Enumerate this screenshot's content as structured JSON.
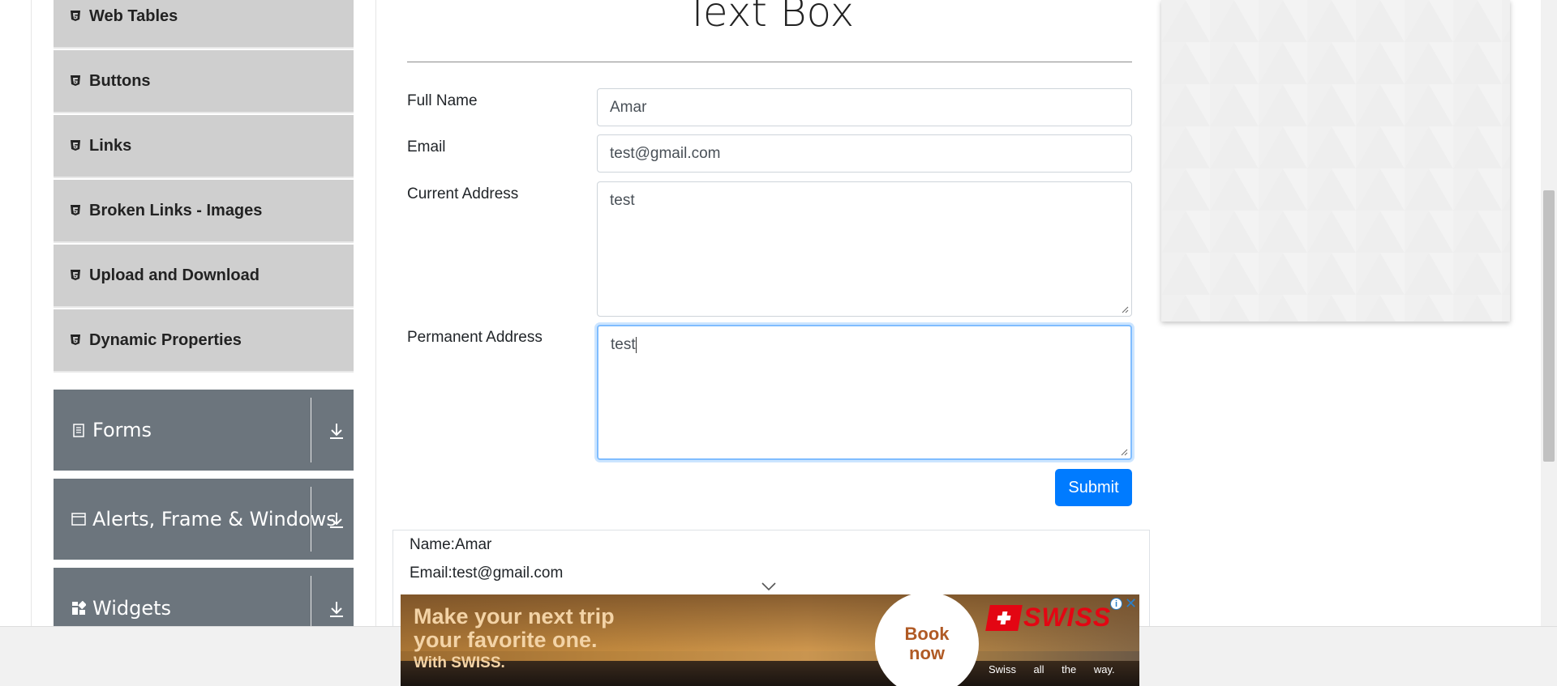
{
  "sidebar": {
    "items": [
      {
        "label": "Web Tables"
      },
      {
        "label": "Buttons"
      },
      {
        "label": "Links"
      },
      {
        "label": "Broken Links - Images"
      },
      {
        "label": "Upload and Download"
      },
      {
        "label": "Dynamic Properties"
      }
    ],
    "groups": [
      {
        "label": "Forms",
        "icon": "document-icon"
      },
      {
        "label": "Alerts, Frame & Windows",
        "icon": "window-icon"
      },
      {
        "label": "Widgets",
        "icon": "widgets-icon"
      }
    ]
  },
  "main": {
    "title": "Text Box",
    "form": {
      "full_name_label": "Full Name",
      "full_name_value": "Amar",
      "email_label": "Email",
      "email_value": "test@gmail.com",
      "current_address_label": "Current Address",
      "current_address_value": "test",
      "permanent_address_label": "Permanent Address",
      "permanent_address_value": "test",
      "submit_label": "Submit"
    },
    "output": {
      "name": "Name:Amar",
      "email": "Email:test@gmail.com"
    }
  },
  "banner": {
    "line1": "Make your next trip",
    "line2": "your favorite one.",
    "line3": "With SWISS.",
    "book_line1": "Book",
    "book_line2": "now",
    "brand": "SWISS",
    "tagline": "Swiss all the way.",
    "info": "i",
    "close": "✕"
  },
  "colors": {
    "primary": "#007bff",
    "sidebar_group": "#6c757d",
    "sidebar_item": "#cfcfcf",
    "swiss_red": "#e30613"
  }
}
